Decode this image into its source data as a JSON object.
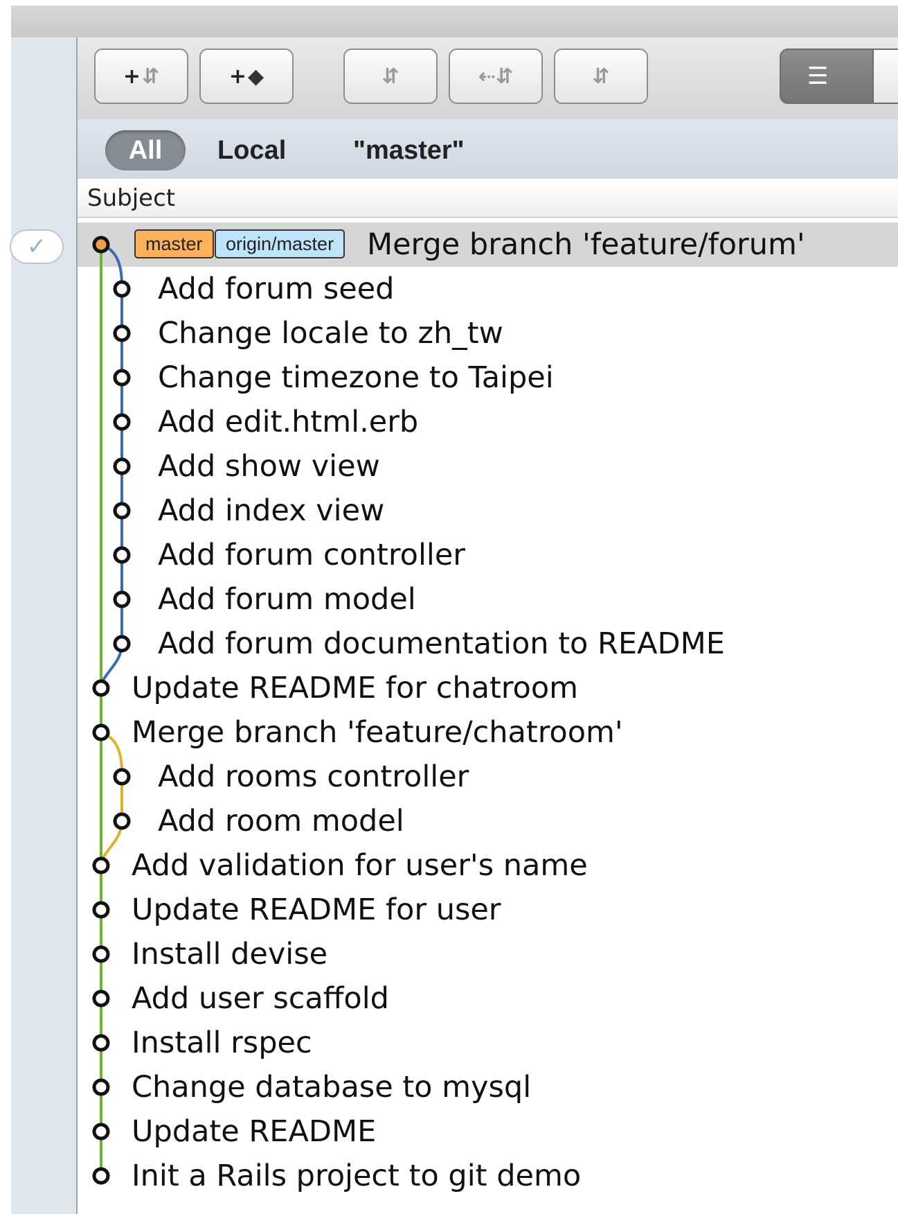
{
  "toolbar": {
    "buttons": [
      {
        "name": "add-branch-button",
        "label": "+⇵"
      },
      {
        "name": "add-tag-button",
        "label": "+⬤"
      },
      {
        "name": "checkout-button",
        "label": "⇵"
      },
      {
        "name": "merge-button",
        "label": "⇠⇵"
      },
      {
        "name": "rebase-button",
        "label": "⇵"
      }
    ],
    "view_toggle_icon": "list-icon"
  },
  "scope": {
    "all": "All",
    "local": "Local",
    "current_branch": "\"master\""
  },
  "columns": {
    "subject": "Subject"
  },
  "commits": [
    {
      "subject": "Merge branch 'feature/forum'",
      "lane": 0,
      "refs": [
        "master",
        "origin/master"
      ],
      "selected": true
    },
    {
      "subject": "Add forum seed",
      "lane": 1
    },
    {
      "subject": "Change locale to zh_tw",
      "lane": 1
    },
    {
      "subject": "Change timezone to Taipei",
      "lane": 1
    },
    {
      "subject": "Add edit.html.erb",
      "lane": 1
    },
    {
      "subject": "Add show view",
      "lane": 1
    },
    {
      "subject": "Add index view",
      "lane": 1
    },
    {
      "subject": "Add forum controller",
      "lane": 1
    },
    {
      "subject": "Add forum model",
      "lane": 1
    },
    {
      "subject": "Add forum documentation to README",
      "lane": 1
    },
    {
      "subject": "Update README for chatroom",
      "lane": 0
    },
    {
      "subject": "Merge branch 'feature/chatroom'",
      "lane": 0
    },
    {
      "subject": "Add rooms controller",
      "lane": 1
    },
    {
      "subject": "Add room model",
      "lane": 1
    },
    {
      "subject": "Add validation for user's name",
      "lane": 0
    },
    {
      "subject": "Update README for user",
      "lane": 0
    },
    {
      "subject": "Install devise",
      "lane": 0
    },
    {
      "subject": "Add user scaffold",
      "lane": 0
    },
    {
      "subject": "Install rspec",
      "lane": 0
    },
    {
      "subject": "Change database to mysql",
      "lane": 0
    },
    {
      "subject": "Update README",
      "lane": 0
    },
    {
      "subject": "Init a Rails project to git demo",
      "lane": 0
    }
  ],
  "colors": {
    "main_line": "#6fb52c",
    "forum_branch": "#3b6bb5",
    "chatroom_branch": "#e0b12b",
    "head_node": "#f0a040",
    "master_tag": "#ffb15c",
    "origin_tag": "#bfe3fb"
  }
}
